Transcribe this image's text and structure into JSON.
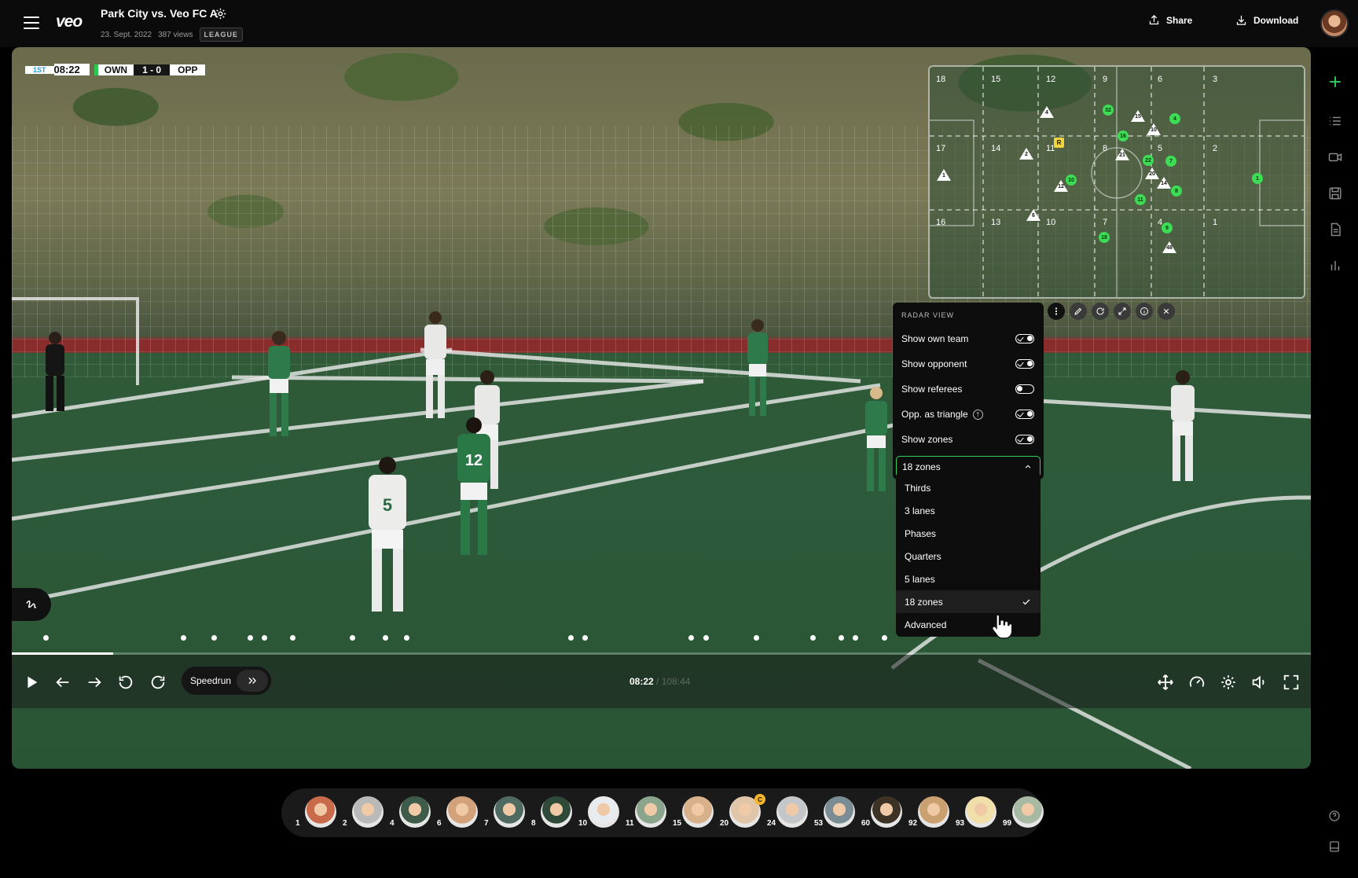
{
  "header": {
    "logo": "veo",
    "title": "Park City vs. Veo FC A",
    "date": "23. Sept. 2022",
    "views": "387 views",
    "badge": "LEAGUE",
    "share_label": "Share",
    "download_label": "Download"
  },
  "scoreboard": {
    "period": "1ST",
    "clock": "08:22",
    "own_label": "OWN",
    "score": "1 - 0",
    "opp_label": "OPP"
  },
  "radar": {
    "zone_numbers": [
      "18",
      "15",
      "12",
      "9",
      "6",
      "3",
      "17",
      "14",
      "11",
      "8",
      "5",
      "2",
      "16",
      "13",
      "10",
      "7",
      "4",
      "1"
    ],
    "own_players": [
      "32",
      "16",
      "4",
      "22",
      "7",
      "10",
      "11",
      "8",
      "9",
      "18",
      "1"
    ],
    "opponents": [
      "4",
      "15",
      "10",
      "2",
      "21",
      "20",
      "12",
      "6",
      "14",
      "48",
      "1"
    ],
    "referee_label": "R"
  },
  "radar_panel": {
    "title": "RADAR VIEW",
    "toggles": [
      {
        "label": "Show own team",
        "on": true
      },
      {
        "label": "Show opponent",
        "on": true
      },
      {
        "label": "Show referees",
        "on": false
      },
      {
        "label": "Opp. as triangle",
        "on": true
      },
      {
        "label": "Show zones",
        "on": true
      }
    ],
    "selected_zone": "18 zones",
    "zone_options": [
      "Thirds",
      "3 lanes",
      "Phases",
      "Quarters",
      "5 lanes",
      "18 zones",
      "Advanced"
    ]
  },
  "playback": {
    "progress": 0.078,
    "speedrun_label": "Speedrun",
    "current_time": "08:22",
    "separator": "/",
    "total_time": "108:44"
  },
  "players": [
    {
      "number": "1",
      "color": "#c96a4a"
    },
    {
      "number": "2",
      "color": "#b9b9b9"
    },
    {
      "number": "4",
      "color": "#3f5c4a"
    },
    {
      "number": "6",
      "color": "#d4a27a"
    },
    {
      "number": "7",
      "color": "#4f6a60"
    },
    {
      "number": "8",
      "color": "#2f4a38"
    },
    {
      "number": "10",
      "color": "#e9ecef"
    },
    {
      "number": "11",
      "color": "#8aa58c"
    },
    {
      "number": "15",
      "color": "#d8b08a"
    },
    {
      "number": "20",
      "color": "#e0c5a8"
    },
    {
      "number": "24",
      "color": "#c4c7c9"
    },
    {
      "number": "53",
      "color": "#7a8d94"
    },
    {
      "number": "60",
      "color": "#3d3324"
    },
    {
      "number": "92",
      "color": "#caa070"
    },
    {
      "number": "93",
      "color": "#f0dfa8"
    },
    {
      "number": "99",
      "color": "#a7b8a3"
    }
  ],
  "captain_label": "C"
}
